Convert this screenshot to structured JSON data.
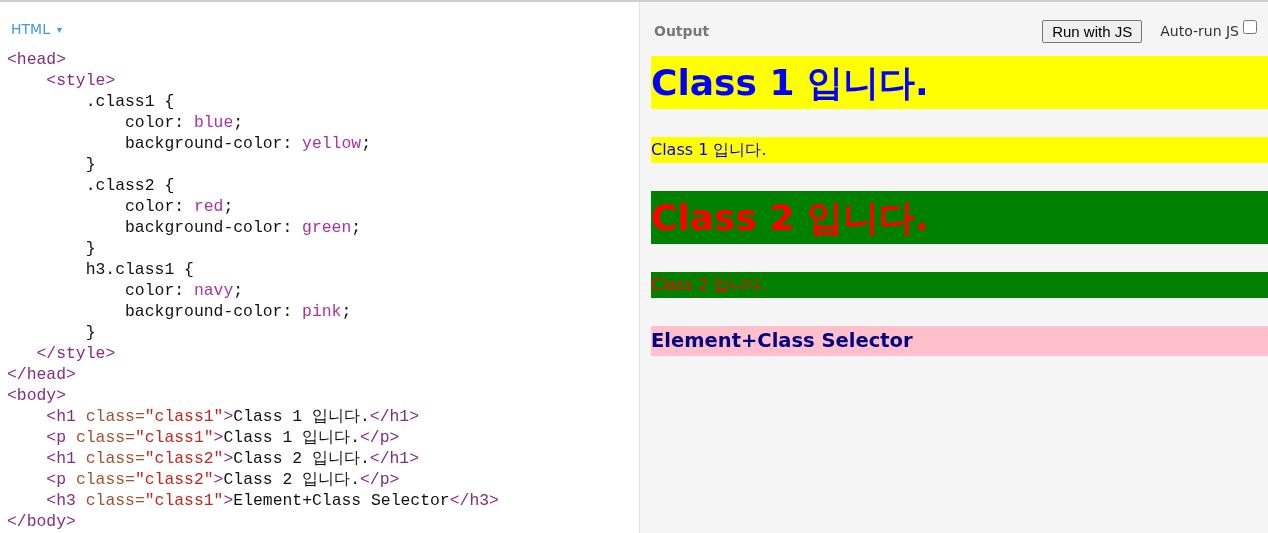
{
  "editor": {
    "language": "HTML",
    "caret": "▾",
    "lines": [
      "<head>",
      "    <style>",
      "        .class1 {",
      "            color: blue;",
      "            background-color: yellow;",
      "        }",
      "        .class2 {",
      "            color: red;",
      "            background-color: green;",
      "        }",
      "        h3.class1 {",
      "            color: navy;",
      "            background-color: pink;",
      "        }",
      "   </style>",
      "</head>",
      "<body>",
      "    <h1 class=\"class1\">Class 1 입니다.</h1>",
      "    <p class=\"class1\">Class 1 입니다.</p>",
      "    <h1 class=\"class2\">Class 2 입니다.</h1>",
      "    <p class=\"class2\">Class 2 입니다.</p>",
      "    <h3 class=\"class1\">Element+Class Selector</h3>",
      "</body>"
    ]
  },
  "output": {
    "title": "Output",
    "run_button": "Run with JS",
    "auto_run": {
      "label": "Auto-run JS",
      "checked": false
    },
    "blocks": [
      {
        "kind": "h1class1",
        "text": "Class 1 입니다.",
        "highlight": {
          "color": "#ffff00"
        }
      },
      {
        "kind": "pclass1",
        "text": "Class 1 입니다.",
        "highlight": {
          "color": "#ffff00"
        }
      },
      {
        "kind": "h1class2",
        "text": "Class 2 입니다.",
        "highlight": {
          "color": "#008000"
        }
      },
      {
        "kind": "pclass2",
        "text": "Class 2 입니다.",
        "highlight": {
          "color": "#008000"
        }
      },
      {
        "kind": "h3class1",
        "text": "Element+Class Selector",
        "highlight": {
          "color": "#ffc0cb"
        }
      }
    ]
  }
}
